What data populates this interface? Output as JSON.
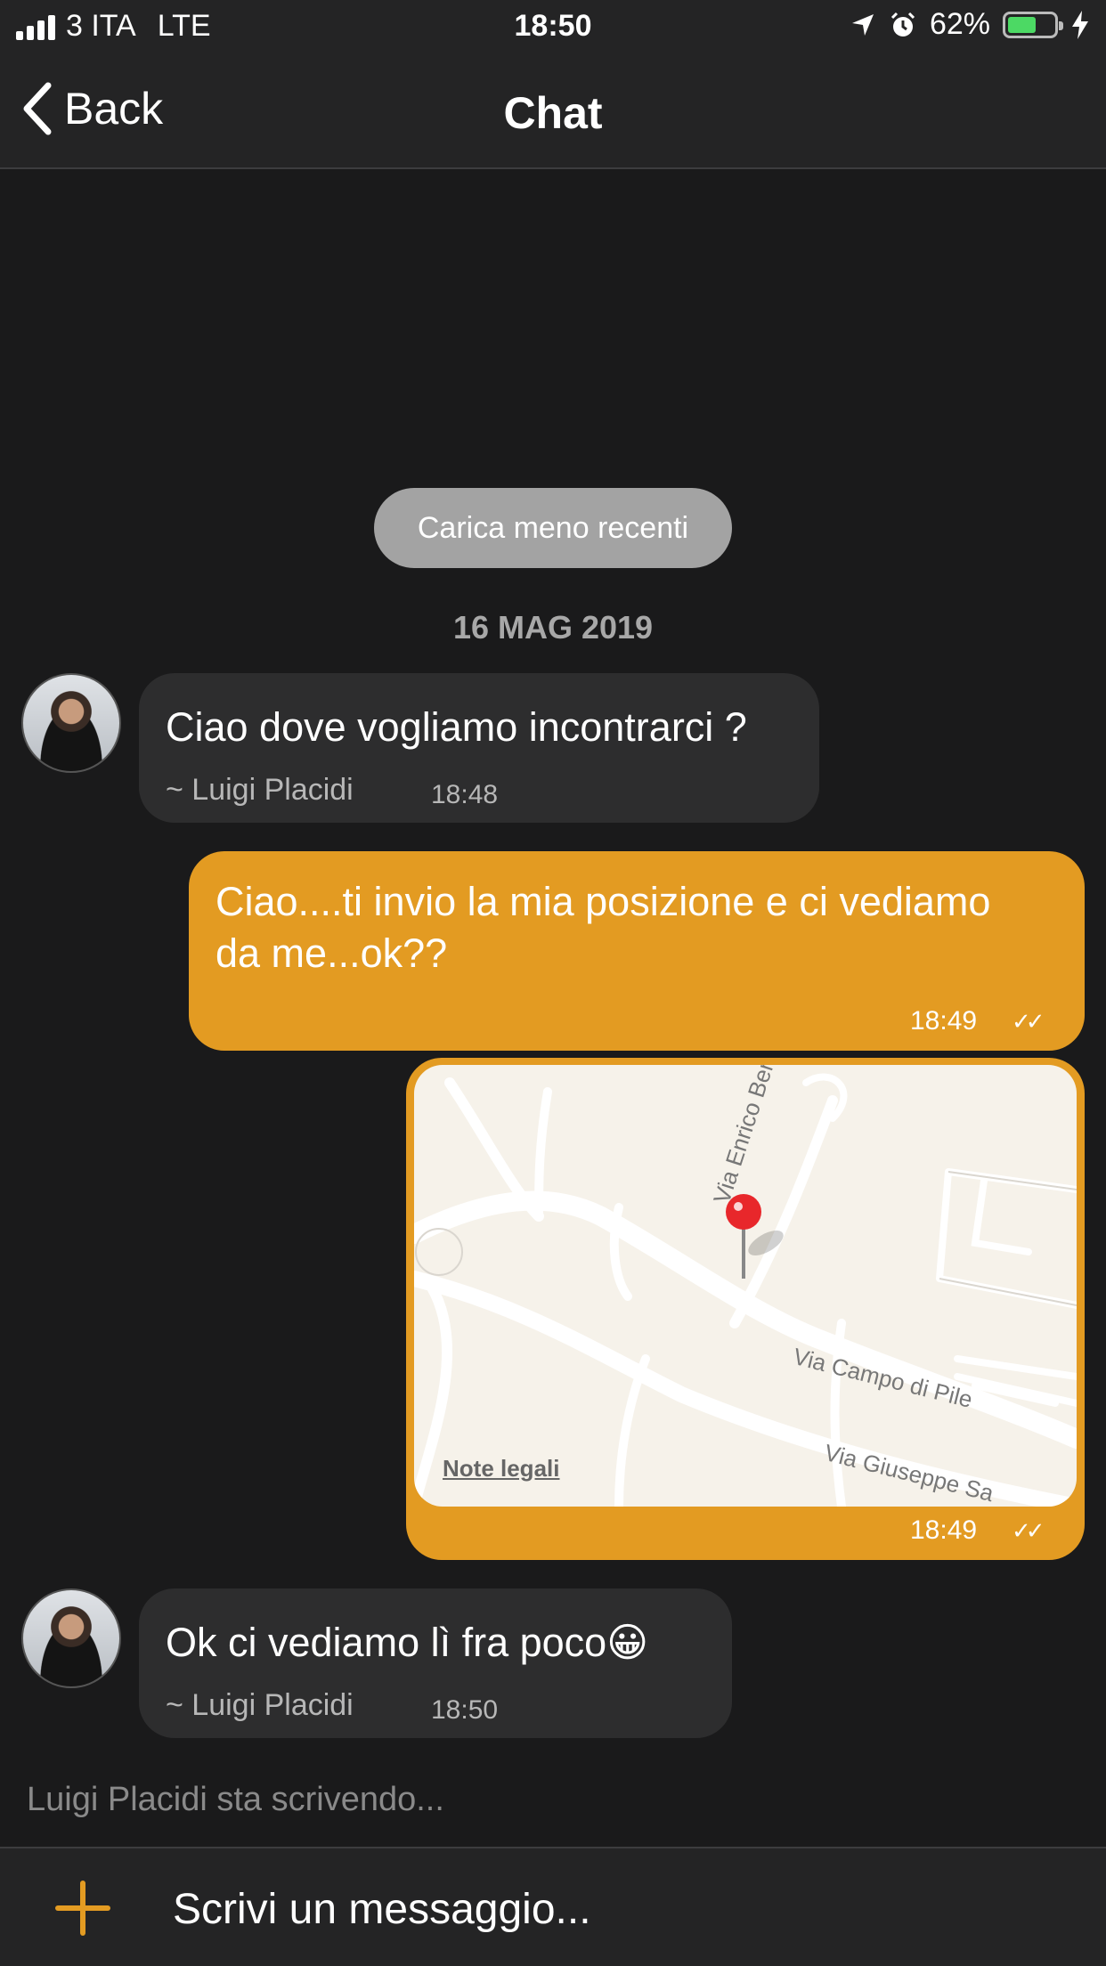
{
  "status_bar": {
    "carrier": "3 ITA",
    "network": "LTE",
    "time": "18:50",
    "battery_percent": "62%",
    "battery_level": 0.62
  },
  "nav": {
    "back_label": "Back",
    "title": "Chat"
  },
  "load_more_label": "Carica meno recenti",
  "date_separator": "16 MAG 2019",
  "messages": [
    {
      "direction": "in",
      "text": "Ciao dove vogliamo incontrarci ?",
      "sender": "~ Luigi Placidi",
      "time": "18:48"
    },
    {
      "direction": "out",
      "text_line1": "Ciao....ti invio la mia posizione e ci vediamo",
      "text_line2": "da me...ok??",
      "time": "18:49",
      "ticks": "✓✓"
    },
    {
      "direction": "out",
      "type": "location",
      "map_labels": {
        "street1": "Via Enrico Berlinguer",
        "street2": "Via Campo di Pile",
        "street3": "Via Giuseppe Sa",
        "legal": "Note legali"
      },
      "time": "18:49",
      "ticks": "✓✓"
    },
    {
      "direction": "in",
      "text": "Ok ci vediamo lì fra poco😀",
      "sender": "~ Luigi Placidi",
      "time": "18:50"
    }
  ],
  "typing_indicator": "Luigi Placidi sta scrivendo...",
  "composer": {
    "placeholder": "Scrivi un messaggio..."
  },
  "colors": {
    "accent": "#e39b22",
    "background": "#1a1a1b",
    "bar": "#242425",
    "incoming_bubble": "#2d2d2e"
  }
}
